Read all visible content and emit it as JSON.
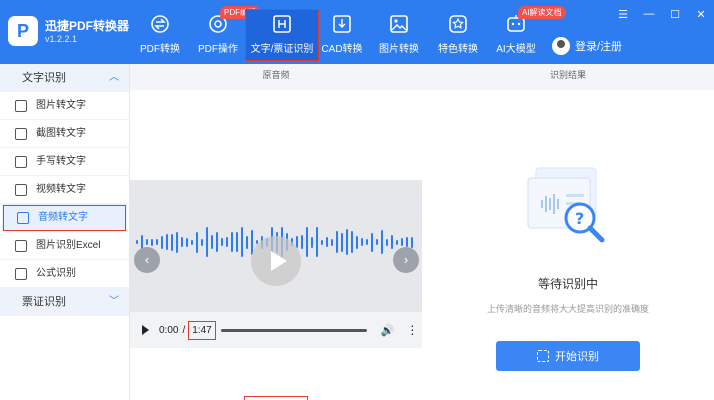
{
  "app": {
    "logo_letter": "P",
    "name": "迅捷PDF转换器",
    "version": "v1.2.2.1"
  },
  "nav": [
    {
      "label": "PDF转换",
      "icon": "exchange-icon",
      "badge": ""
    },
    {
      "label": "PDF操作",
      "icon": "pdf-ops-icon",
      "badge": "PDF编辑"
    },
    {
      "label": "文字/票证识别",
      "icon": "ocr-icon",
      "badge": ""
    },
    {
      "label": "CAD转换",
      "icon": "cad-icon",
      "badge": ""
    },
    {
      "label": "图片转换",
      "icon": "image-icon",
      "badge": ""
    },
    {
      "label": "特色转换",
      "icon": "star-icon",
      "badge": ""
    },
    {
      "label": "AI大模型",
      "icon": "ai-icon",
      "badge": "AI解读文档"
    }
  ],
  "active_nav": "文字/票证识别",
  "login": {
    "label": "登录/注册"
  },
  "window_controls": [
    "☰",
    "—",
    "☐",
    "✕"
  ],
  "sidebar": {
    "section1": {
      "title": "文字识别",
      "chevron": "︿"
    },
    "items": [
      {
        "label": "图片转文字",
        "icon": "text-icon"
      },
      {
        "label": "截图转文字",
        "icon": "screenshot-icon"
      },
      {
        "label": "手写转文字",
        "icon": "handwrite-icon"
      },
      {
        "label": "视频转文字",
        "icon": "video-icon"
      },
      {
        "label": "音频转文字",
        "icon": "audio-icon"
      },
      {
        "label": "图片识别Excel",
        "icon": "excel-icon"
      },
      {
        "label": "公式识别",
        "icon": "formula-icon"
      }
    ],
    "active_item": "音频转文字",
    "section2": {
      "title": "票证识别",
      "chevron": "﹀"
    }
  },
  "columns": {
    "left": "原音频",
    "right": "识别结果"
  },
  "player": {
    "current_time": "0:00",
    "separator": "/",
    "duration": "1:47",
    "prev": "‹",
    "next": "›",
    "volume": "🔊",
    "more": "⋮"
  },
  "result": {
    "title": "等待识别中",
    "subtitle": "上传清晰的音频将大大提高识别的准确度",
    "start_button": "开始识别"
  },
  "colors": {
    "primary": "#2d7cf0",
    "highlight": "#e23a2e"
  }
}
